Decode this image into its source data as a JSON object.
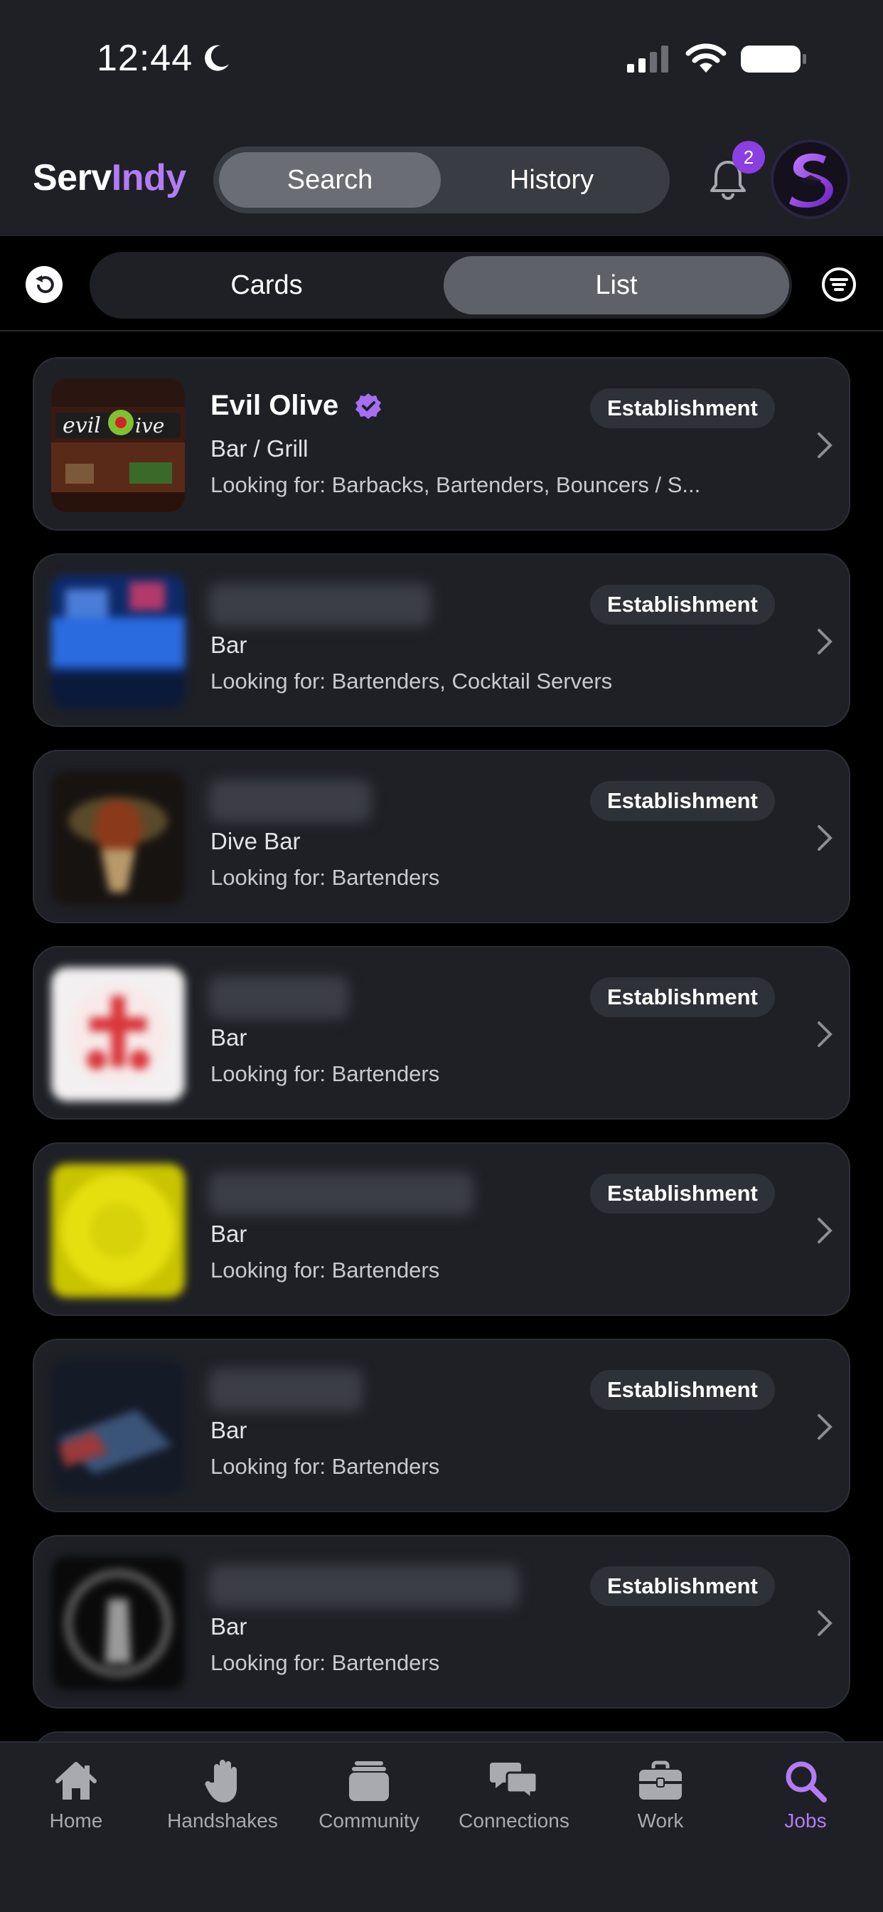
{
  "status_bar": {
    "time": "12:44"
  },
  "header": {
    "brand_part1": "Serv",
    "brand_part2": "Indy",
    "tabs": [
      {
        "label": "Search",
        "active": true
      },
      {
        "label": "History",
        "active": false
      }
    ],
    "notification_count": "2"
  },
  "view_toggle": {
    "options": [
      {
        "label": "Cards",
        "active": false
      },
      {
        "label": "List",
        "active": true
      }
    ]
  },
  "colors": {
    "accent": "#b37cf5",
    "background": "#000000",
    "surface": "#1e2026"
  },
  "listings": [
    {
      "name": "Evil Olive",
      "verified": true,
      "badge": "Establishment",
      "type": "Bar / Grill",
      "looking_for": "Looking for: Barbacks, Bartenders, Bouncers / S...",
      "name_blurred": false
    },
    {
      "name": "",
      "verified": false,
      "badge": "Establishment",
      "type": "Bar",
      "looking_for": "Looking for: Bartenders, Cocktail Servers",
      "name_blurred": true
    },
    {
      "name": "",
      "verified": false,
      "badge": "Establishment",
      "type": "Dive Bar",
      "looking_for": "Looking for: Bartenders",
      "name_blurred": true
    },
    {
      "name": "",
      "verified": false,
      "badge": "Establishment",
      "type": "Bar",
      "looking_for": "Looking for: Bartenders",
      "name_blurred": true
    },
    {
      "name": "",
      "verified": false,
      "badge": "Establishment",
      "type": "Bar",
      "looking_for": "Looking for: Bartenders",
      "name_blurred": true
    },
    {
      "name": "",
      "verified": false,
      "badge": "Establishment",
      "type": "Bar",
      "looking_for": "Looking for: Bartenders",
      "name_blurred": true
    },
    {
      "name": "",
      "verified": false,
      "badge": "Establishment",
      "type": "Bar",
      "looking_for": "Looking for: Bartenders",
      "name_blurred": true
    }
  ],
  "tab_bar": [
    {
      "label": "Home",
      "icon": "home-icon",
      "active": false
    },
    {
      "label": "Handshakes",
      "icon": "hand-icon",
      "active": false
    },
    {
      "label": "Community",
      "icon": "community-icon",
      "active": false
    },
    {
      "label": "Connections",
      "icon": "chat-bubbles-icon",
      "active": false
    },
    {
      "label": "Work",
      "icon": "briefcase-icon",
      "active": false
    },
    {
      "label": "Jobs",
      "icon": "search-icon",
      "active": true
    }
  ]
}
